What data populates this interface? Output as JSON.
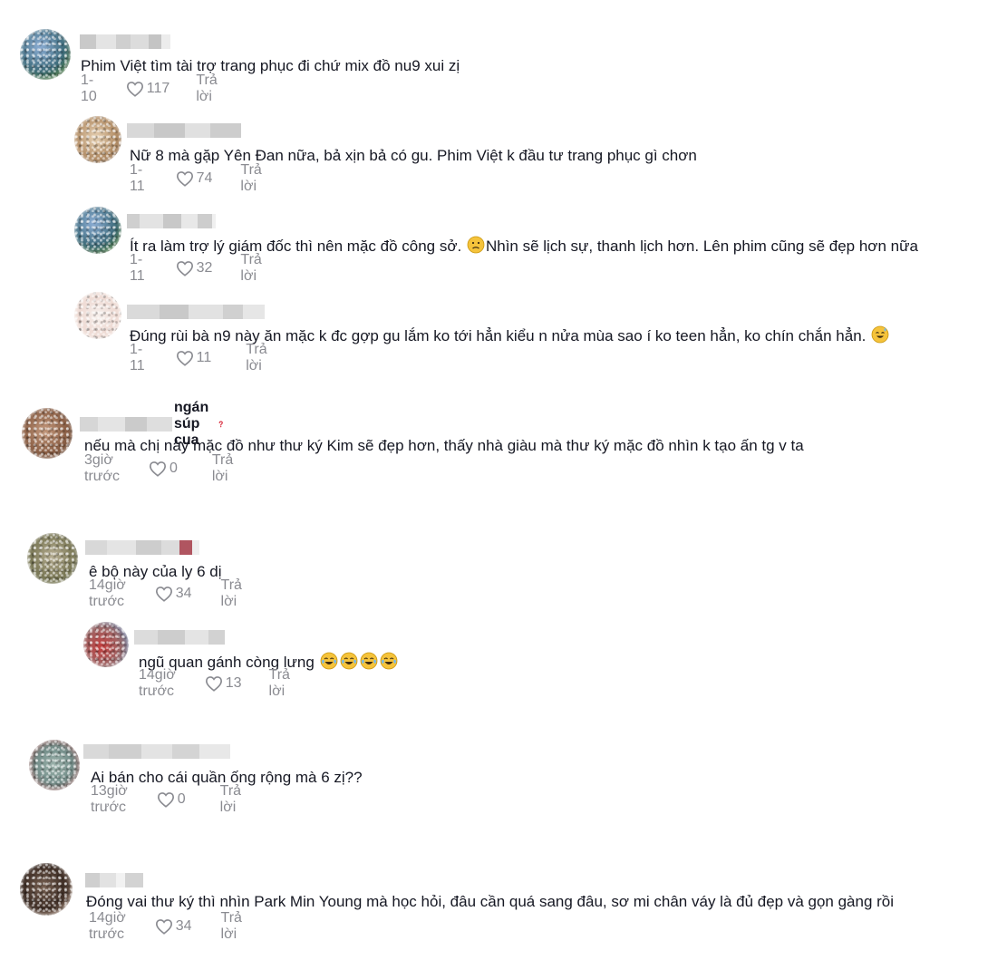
{
  "comments": [
    {
      "name": "",
      "text": "Phim Việt tìm tài trợ trang phục đi chứ mix đồ nu9 xui zị",
      "date": "1-10",
      "likes": "117",
      "reply": "Trả lời"
    },
    {
      "name": "",
      "text": "Nữ 8 mà gặp Yên Đan nữa, bả xịn bả có gu. Phim Việt k đầu tư trang phục gì chơn",
      "date": "1-11",
      "likes": "74",
      "reply": "Trả lời"
    },
    {
      "name": "",
      "text_before": "Ít ra làm trợ lý giám đốc thì nên mặc đồ công sở.",
      "text_after": "Nhìn sẽ lịch sự, thanh lịch hơn. Lên phim cũng sẽ đẹp hơn nữa",
      "date": "1-11",
      "likes": "32",
      "reply": "Trả lời",
      "emoji": "slightly-frowning-face"
    },
    {
      "name": "",
      "text": "Đúng rùi bà n9 này ăn mặc k đc gợp gu lắm ko tới hẳn kiểu n nửa mùa sao í ko teen hẳn, ko chín chắn hẳn.",
      "date": "1-11",
      "likes": "11",
      "reply": "Trả lời",
      "emoji": "sweat-smile-face"
    },
    {
      "name": "ngán súp cua",
      "text": "nếu mà chị này mặc đồ như thư ký Kim sẽ đẹp hơn, thấy nhà giàu mà thư ký mặc đồ nhìn k tạo ấn tg v ta",
      "date": "3giờ trước",
      "likes": "0",
      "reply": "Trả lời",
      "emoji": "question-mark"
    },
    {
      "name": "",
      "text": "ê bộ này của ly 6 dị",
      "date": "14giờ trước",
      "likes": "34",
      "reply": "Trả lời"
    },
    {
      "name": "",
      "text": "ngũ quan gánh còng lưng",
      "date": "14giờ trước",
      "likes": "13",
      "reply": "Trả lời",
      "emoji": "tears-of-joy-face"
    },
    {
      "name": "",
      "text": "Ai bán cho cái quần ống rộng mà 6 zị??",
      "date": "13giờ trước",
      "likes": "0",
      "reply": "Trả lời"
    },
    {
      "name": "",
      "text": "Đóng vai thư ký thì nhìn Park Min Young mà học hỏi, đâu cần quá sang đâu, sơ mi chân váy là đủ đẹp và gọn gàng rồi",
      "date": "14giờ trước",
      "likes": "34",
      "reply": "Trả lời"
    }
  ],
  "colors": {
    "meta": "#8a8b91",
    "text": "#161823"
  }
}
